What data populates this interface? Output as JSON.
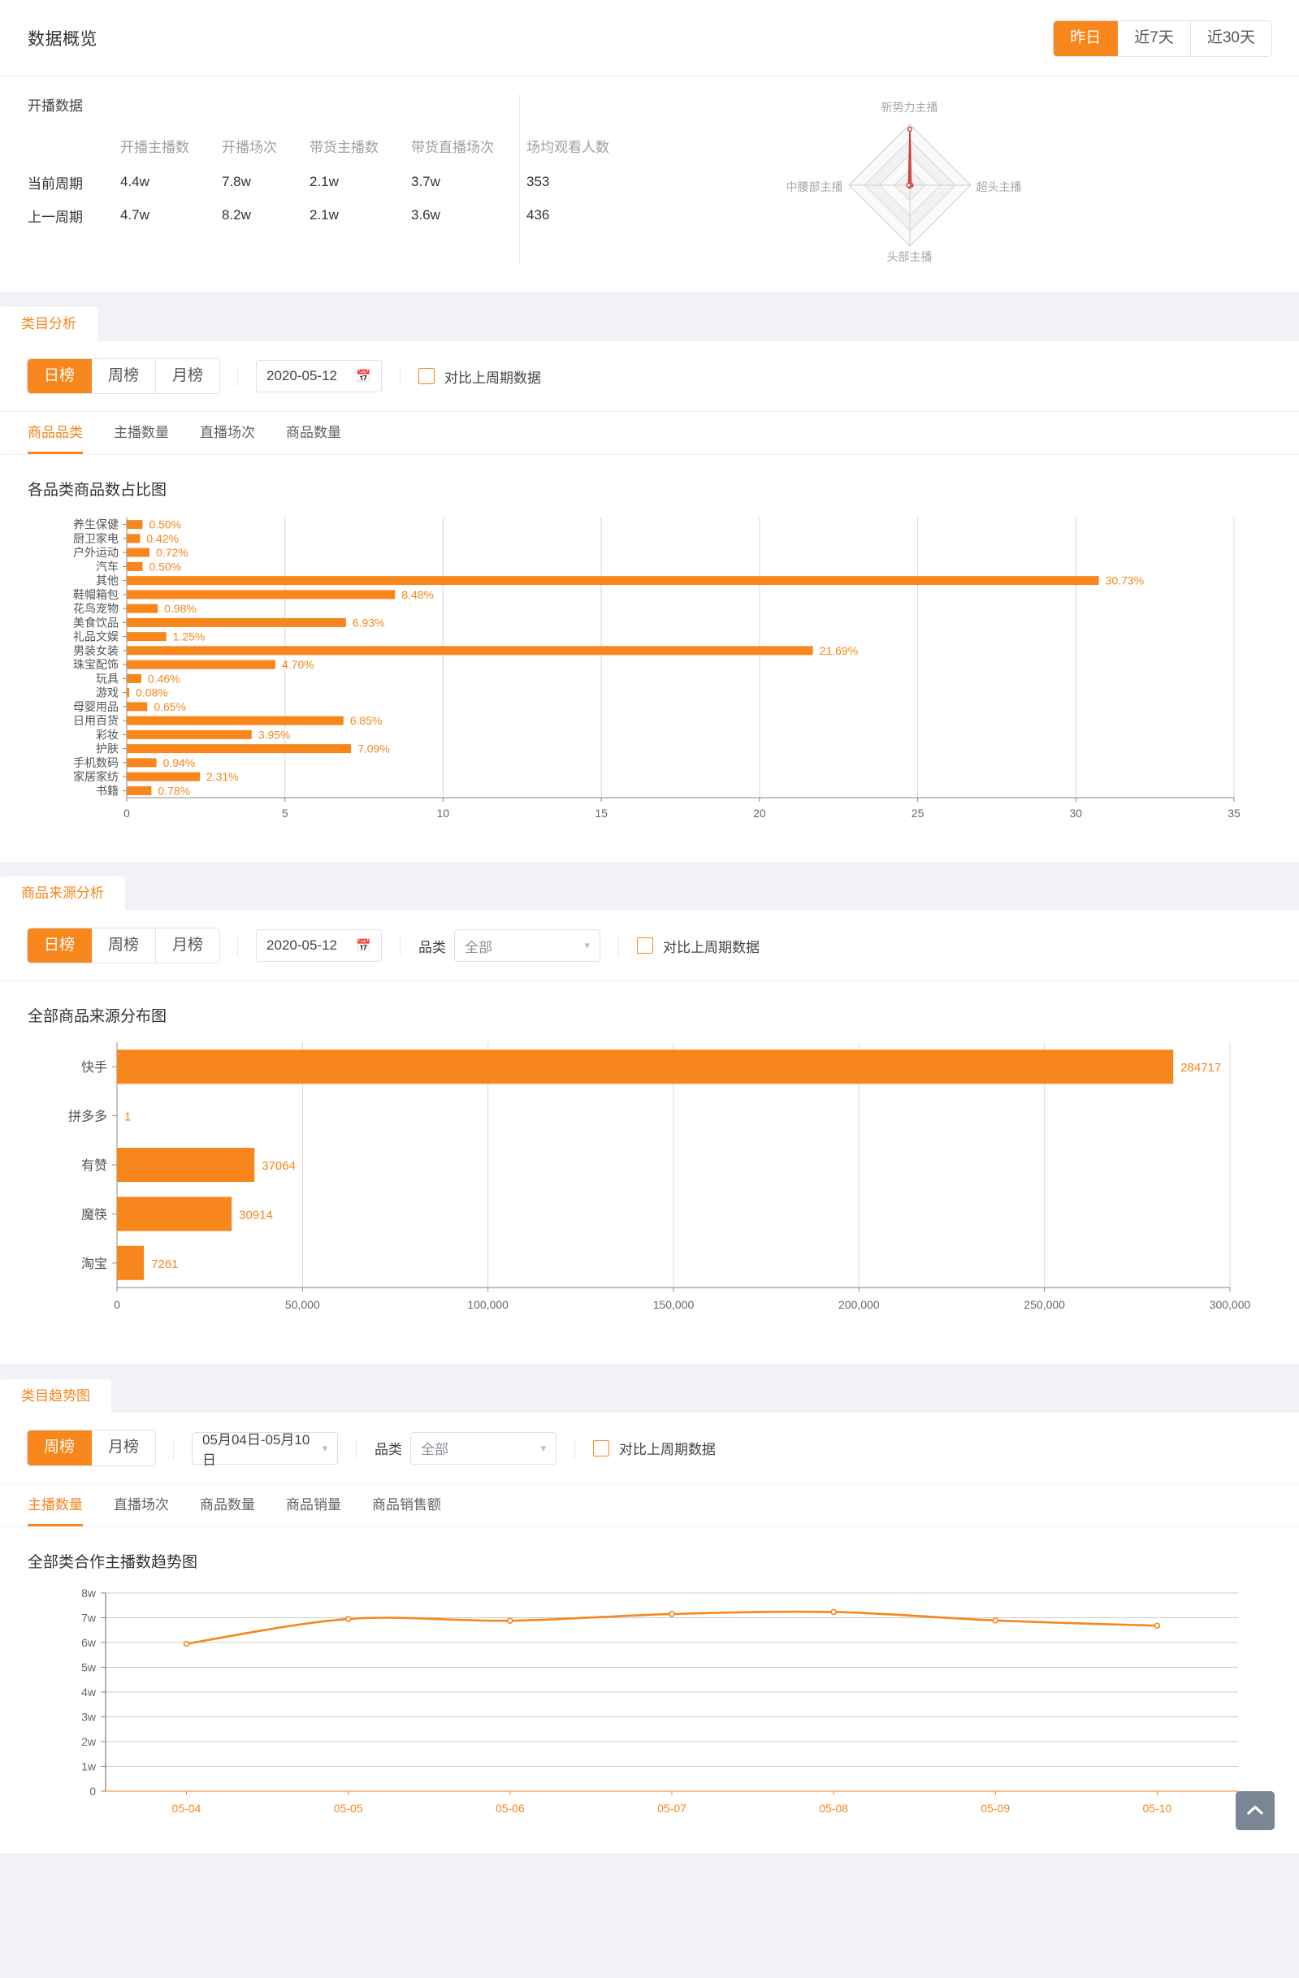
{
  "overview": {
    "title": "数据概览",
    "range_buttons": [
      {
        "label": "昨日",
        "active": true
      },
      {
        "label": "近7天",
        "active": false
      },
      {
        "label": "近30天",
        "active": false
      }
    ],
    "section_label": "开播数据",
    "columns": [
      "开播主播数",
      "开播场次",
      "带货主播数",
      "带货直播场次",
      "场均观看人数"
    ],
    "rows": [
      {
        "label": "当前周期",
        "values": [
          "4.4w",
          "7.8w",
          "2.1w",
          "3.7w",
          "353"
        ]
      },
      {
        "label": "上一周期",
        "values": [
          "4.7w",
          "8.2w",
          "2.1w",
          "3.6w",
          "436"
        ]
      }
    ],
    "radar": {
      "axes": [
        "新势力主播",
        "超头主播",
        "头部主播",
        "中腰部主播"
      ],
      "values": [
        0.92,
        0.02,
        0.0,
        0.0
      ],
      "series_color": "#cf3a3a"
    }
  },
  "category_panel": {
    "tab_label": "类目分析",
    "rank_buttons": [
      {
        "label": "日榜",
        "active": true
      },
      {
        "label": "周榜",
        "active": false
      },
      {
        "label": "月榜",
        "active": false
      }
    ],
    "date_value": "2020-05-12",
    "compare_label": "对比上周期数据",
    "subtabs": [
      {
        "label": "商品品类",
        "active": true
      },
      {
        "label": "主播数量",
        "active": false
      },
      {
        "label": "直播场次",
        "active": false
      },
      {
        "label": "商品数量",
        "active": false
      }
    ],
    "chart_title": "各品类商品数占比图"
  },
  "source_panel": {
    "tab_label": "商品来源分析",
    "rank_buttons": [
      {
        "label": "日榜",
        "active": true
      },
      {
        "label": "周榜",
        "active": false
      },
      {
        "label": "月榜",
        "active": false
      }
    ],
    "date_value": "2020-05-12",
    "category_label": "品类",
    "category_value": "全部",
    "compare_label": "对比上周期数据",
    "chart_title": "全部商品来源分布图"
  },
  "trend_panel": {
    "tab_label": "类目趋势图",
    "rank_buttons": [
      {
        "label": "周榜",
        "active": true
      },
      {
        "label": "月榜",
        "active": false
      }
    ],
    "date_value": "05月04日-05月10日",
    "category_label": "品类",
    "category_value": "全部",
    "compare_label": "对比上周期数据",
    "subtabs": [
      {
        "label": "主播数量",
        "active": true
      },
      {
        "label": "直播场次",
        "active": false
      },
      {
        "label": "商品数量",
        "active": false
      },
      {
        "label": "商品销量",
        "active": false
      },
      {
        "label": "商品销售额",
        "active": false
      }
    ],
    "chart_title": "全部类合作主播数趋势图"
  },
  "back_to_top": {
    "icon": "chevron-up-icon"
  },
  "theme": {
    "accent": "#F7861C",
    "bar_fill": "#F7861C",
    "page_bg": "#f0f2f5",
    "axis": "#666666",
    "grid": "#cccccc"
  },
  "chart_data": [
    {
      "id": "category_share_bar",
      "type": "bar",
      "orientation": "horizontal",
      "title": "各品类商品数占比图",
      "xlabel": "",
      "ylabel": "",
      "xlim": [
        0,
        35
      ],
      "xticks": [
        0,
        5,
        10,
        15,
        20,
        25,
        30,
        35
      ],
      "grid": true,
      "unit": "%",
      "categories": [
        "养生保健",
        "厨卫家电",
        "户外运动",
        "汽车",
        "其他",
        "鞋帽箱包",
        "花鸟宠物",
        "美食饮品",
        "礼品文娱",
        "男装女装",
        "珠宝配饰",
        "玩具",
        "游戏",
        "母婴用品",
        "日用百货",
        "彩妆",
        "护肤",
        "手机数码",
        "家居家纺",
        "书籍"
      ],
      "values": [
        0.5,
        0.42,
        0.72,
        0.5,
        30.73,
        8.48,
        0.98,
        6.93,
        1.25,
        21.69,
        4.7,
        0.46,
        0.08,
        0.65,
        6.85,
        3.95,
        7.09,
        0.94,
        2.31,
        0.78
      ],
      "labels": [
        "0.50%",
        "0.42%",
        "0.72%",
        "0.50%",
        "30.73%",
        "8.48%",
        "0.98%",
        "6.93%",
        "1.25%",
        "21.69%",
        "4.70%",
        "0.46%",
        "0.08%",
        "0.65%",
        "6.85%",
        "3.95%",
        "7.09%",
        "0.94%",
        "2.31%",
        "0.78%"
      ]
    },
    {
      "id": "product_source_bar",
      "type": "bar",
      "orientation": "horizontal",
      "title": "全部商品来源分布图",
      "xlabel": "",
      "ylabel": "",
      "xlim": [
        0,
        300000
      ],
      "xticks": [
        0,
        50000,
        100000,
        150000,
        200000,
        250000,
        300000
      ],
      "xticklabels": [
        "0",
        "50,000",
        "100,000",
        "150,000",
        "200,000",
        "250,000",
        "300,000"
      ],
      "grid": true,
      "categories": [
        "快手",
        "拼多多",
        "有赞",
        "魔筷",
        "淘宝"
      ],
      "values": [
        284717,
        1,
        37064,
        30914,
        7261
      ],
      "labels": [
        "284717",
        "1",
        "37064",
        "30914",
        "7261"
      ]
    },
    {
      "id": "anchor_count_trend_line",
      "type": "line",
      "title": "全部类合作主播数趋势图",
      "xlabel": "",
      "ylabel": "",
      "ylim": [
        0,
        80000
      ],
      "yticks": [
        0,
        10000,
        20000,
        30000,
        40000,
        50000,
        60000,
        70000,
        80000
      ],
      "yticklabels": [
        "0",
        "1w",
        "2w",
        "3w",
        "4w",
        "5w",
        "6w",
        "7w",
        "8w"
      ],
      "grid": true,
      "x": [
        "05-04",
        "05-05",
        "05-06",
        "05-07",
        "05-08",
        "05-09",
        "05-10"
      ],
      "series": [
        {
          "name": "主播数量",
          "values": [
            59500,
            69500,
            68800,
            71500,
            72300,
            68900,
            66800
          ],
          "color": "#F7861C"
        }
      ]
    }
  ]
}
